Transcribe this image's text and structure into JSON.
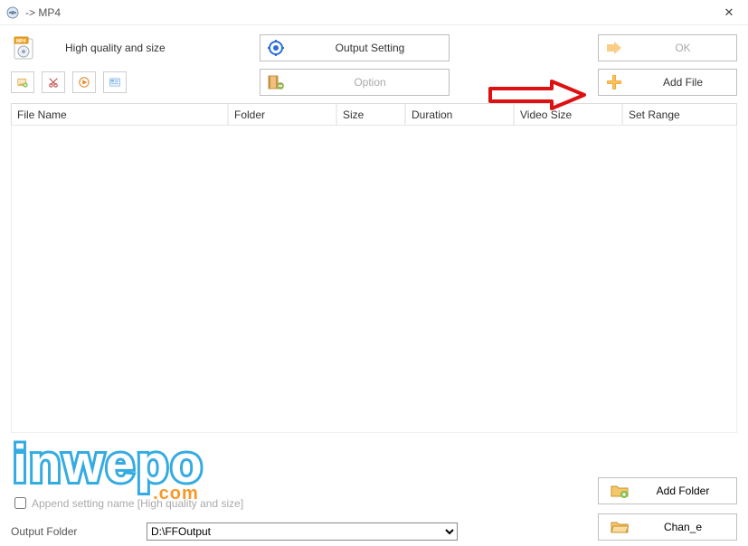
{
  "window": {
    "title": "-> MP4"
  },
  "profile": {
    "quality_label": "High quality and size"
  },
  "buttons": {
    "output_setting": "Output Setting",
    "ok": "OK",
    "option": "Option",
    "add_file": "Add File",
    "add_folder": "Add Folder",
    "change": "Chan_e"
  },
  "columns": {
    "file_name": "File Name",
    "folder": "Folder",
    "size": "Size",
    "duration": "Duration",
    "video_size": "Video Size",
    "set_range": "Set Range"
  },
  "append": {
    "label": "Append setting name [High quality and size]",
    "checked": false
  },
  "output": {
    "label": "Output Folder",
    "value": "D:\\FFOutput"
  },
  "watermark": {
    "text": "inwepo",
    "suffix": ".com"
  }
}
